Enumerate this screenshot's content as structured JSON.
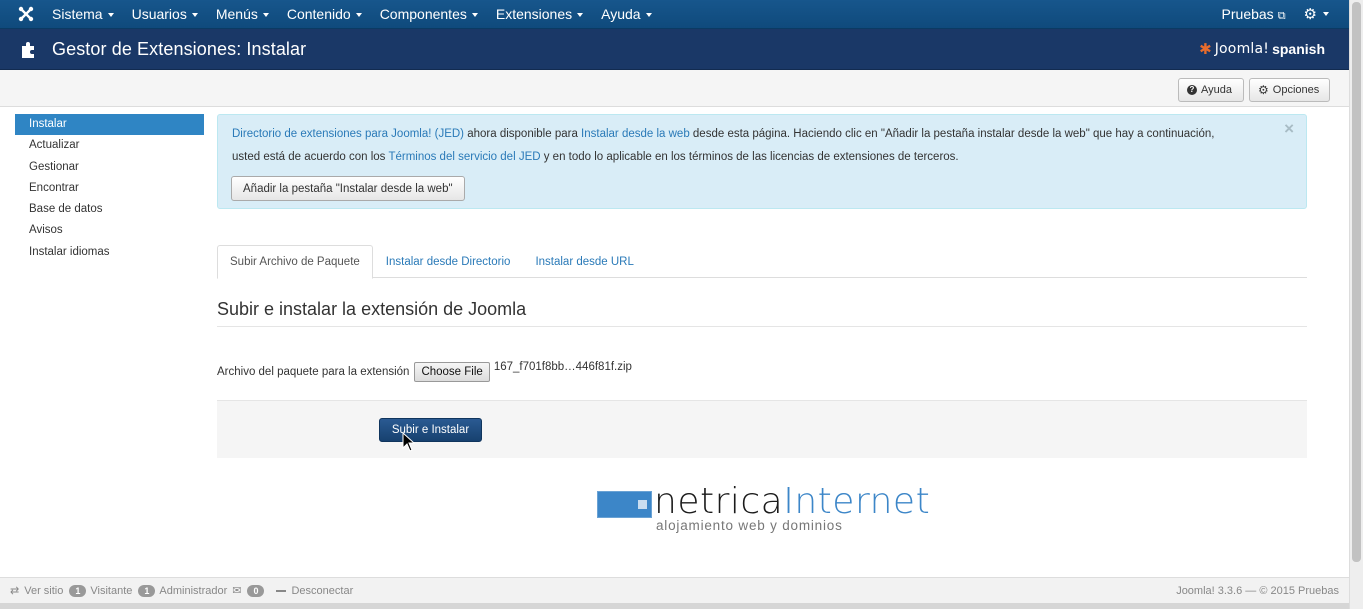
{
  "navbar": {
    "menu": [
      "Sistema",
      "Usuarios",
      "Menús",
      "Contenido",
      "Componentes",
      "Extensiones",
      "Ayuda"
    ],
    "site_link": "Pruebas"
  },
  "header": {
    "title": "Gestor de Extensiones: Instalar",
    "brand_word": "Joomla!",
    "brand_suffix": "spanish"
  },
  "toolbar": {
    "help_label": "Ayuda",
    "options_label": "Opciones"
  },
  "sidebar": {
    "items": [
      "Instalar",
      "Actualizar",
      "Gestionar",
      "Encontrar",
      "Base de datos",
      "Avisos",
      "Instalar idiomas"
    ],
    "active_index": 0
  },
  "alert": {
    "link_jed": "Directorio de extensiones para Joomla! (JED)",
    "text1": " ahora disponible para ",
    "link_web": "Instalar desde la web",
    "text2": " desde esta página.  Haciendo clic en \"Añadir la pestaña instalar desde la web\" que hay a continuación,",
    "text3": "usted está de acuerdo con los ",
    "link_terms": "Términos del servicio del JED",
    "text4": " y en todo lo aplicable en los términos de las licencias de extensiones de terceros.",
    "button_label": "Añadir la pestaña  \"Instalar desde la web\"",
    "close": "×"
  },
  "tabs": [
    "Subir Archivo de Paquete",
    "Instalar desde Directorio",
    "Instalar desde URL"
  ],
  "main": {
    "section_title": "Subir e instalar la extensión de Joomla",
    "file_label": "Archivo del paquete para la extensión",
    "choose_label": "Choose File",
    "file_name": "167_f701f8bb…446f81f.zip",
    "submit_label": "Subir e Instalar"
  },
  "logo": {
    "word1": "netrica",
    "word2": "Internet",
    "tagline": "alojamiento web y dominios"
  },
  "statusbar": {
    "view_site": "Ver sitio",
    "visitors_count": "1",
    "visitors_label": "Visitante",
    "admins_count": "1",
    "admins_label": "Administrador",
    "messages_count": "0",
    "logout": "Desconectar",
    "footer": "Joomla! 3.3.6  —  © 2015 Pruebas"
  },
  "colors": {
    "navbar": "#17568c",
    "header": "#1a3867",
    "active": "#2f85c4",
    "link": "#2a7ab8",
    "alert_bg": "#d9edf7"
  }
}
